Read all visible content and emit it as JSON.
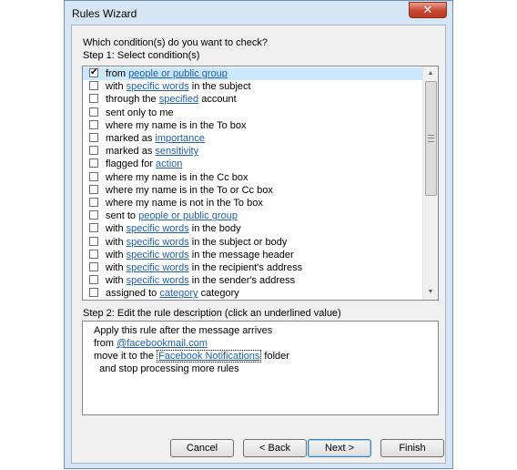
{
  "window": {
    "title": "Rules Wizard",
    "close_glyph": "✕"
  },
  "question": "Which condition(s) do you want to check?",
  "step1_label": "Step 1: Select condition(s)",
  "conditions": [
    {
      "checked": true,
      "parts": [
        {
          "t": "from "
        },
        {
          "t": "people or public group",
          "link": true
        }
      ]
    },
    {
      "checked": false,
      "parts": [
        {
          "t": "with "
        },
        {
          "t": "specific words",
          "link": true
        },
        {
          "t": " in the subject"
        }
      ]
    },
    {
      "checked": false,
      "parts": [
        {
          "t": "through the "
        },
        {
          "t": "specified",
          "link": true
        },
        {
          "t": " account"
        }
      ]
    },
    {
      "checked": false,
      "parts": [
        {
          "t": "sent only to me"
        }
      ]
    },
    {
      "checked": false,
      "parts": [
        {
          "t": "where my name is in the To box"
        }
      ]
    },
    {
      "checked": false,
      "parts": [
        {
          "t": "marked as "
        },
        {
          "t": "importance",
          "link": true
        }
      ]
    },
    {
      "checked": false,
      "parts": [
        {
          "t": "marked as "
        },
        {
          "t": "sensitivity",
          "link": true
        }
      ]
    },
    {
      "checked": false,
      "parts": [
        {
          "t": "flagged for "
        },
        {
          "t": "action",
          "link": true
        }
      ]
    },
    {
      "checked": false,
      "parts": [
        {
          "t": "where my name is in the Cc box"
        }
      ]
    },
    {
      "checked": false,
      "parts": [
        {
          "t": "where my name is in the To or Cc box"
        }
      ]
    },
    {
      "checked": false,
      "parts": [
        {
          "t": "where my name is not in the To box"
        }
      ]
    },
    {
      "checked": false,
      "parts": [
        {
          "t": "sent to "
        },
        {
          "t": "people or public group",
          "link": true
        }
      ]
    },
    {
      "checked": false,
      "parts": [
        {
          "t": "with "
        },
        {
          "t": "specific words",
          "link": true
        },
        {
          "t": " in the body"
        }
      ]
    },
    {
      "checked": false,
      "parts": [
        {
          "t": "with "
        },
        {
          "t": "specific words",
          "link": true
        },
        {
          "t": " in the subject or body"
        }
      ]
    },
    {
      "checked": false,
      "parts": [
        {
          "t": "with "
        },
        {
          "t": "specific words",
          "link": true
        },
        {
          "t": " in the message header"
        }
      ]
    },
    {
      "checked": false,
      "parts": [
        {
          "t": "with "
        },
        {
          "t": "specific words",
          "link": true
        },
        {
          "t": " in the recipient's address"
        }
      ]
    },
    {
      "checked": false,
      "parts": [
        {
          "t": "with "
        },
        {
          "t": "specific words",
          "link": true
        },
        {
          "t": " in the sender's address"
        }
      ]
    },
    {
      "checked": false,
      "parts": [
        {
          "t": "assigned to "
        },
        {
          "t": "category",
          "link": true
        },
        {
          "t": " category"
        }
      ]
    }
  ],
  "scrollbar": {
    "position": 0.0,
    "visible_fraction": 0.5
  },
  "step2_label": "Step 2: Edit the rule description (click an underlined value)",
  "description": {
    "line1": "Apply this rule after the message arrives",
    "line2_prefix": "from ",
    "line2_link": "@facebookmail.com",
    "line3_prefix": "move it to the ",
    "line3_link": "Facebook Notifications",
    "line3_suffix": " folder",
    "line4": "  and stop processing more rules"
  },
  "buttons": {
    "cancel": "Cancel",
    "back": "< Back",
    "next": "Next >",
    "finish": "Finish"
  },
  "colors": {
    "link": "#1f5fb6",
    "selection": "#cce8ff",
    "frame": "#d6e6f5"
  }
}
